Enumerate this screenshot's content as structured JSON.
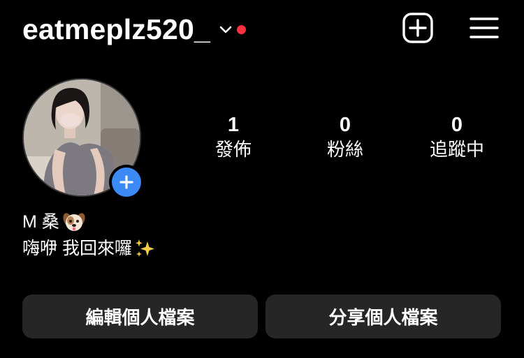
{
  "header": {
    "username": "eatmeplz520_",
    "icons": {
      "switcher": "chevron-down-icon",
      "notification": "red-dot-indicator",
      "new_post": "plus-square-icon",
      "menu": "hamburger-menu-icon"
    },
    "notification_color": "#ff3040"
  },
  "profile": {
    "avatar": "profile-photo",
    "add_story_color": "#3b8af6",
    "stats": [
      {
        "value": "1",
        "label": "發佈"
      },
      {
        "value": "0",
        "label": "粉絲"
      },
      {
        "value": "0",
        "label": "追蹤中"
      }
    ],
    "name": "M 桑",
    "name_emoji": "dog-face-emoji",
    "bio": "嗨咿 我回來囉",
    "bio_emoji": "sparkles-emoji"
  },
  "actions": {
    "edit_profile": "編輯個人檔案",
    "share_profile": "分享個人檔案"
  }
}
